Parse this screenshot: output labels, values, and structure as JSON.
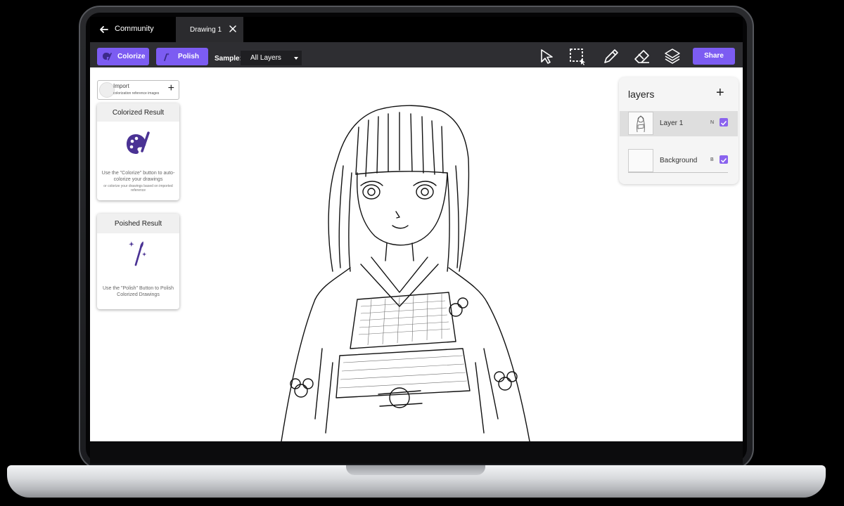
{
  "window": {
    "back_icon": "arrow-left-icon",
    "back_label": "Community",
    "tab": {
      "label": "Drawing 1",
      "close_icon": "close-icon"
    }
  },
  "toolbar": {
    "colorize_label": "Colorize",
    "colorize_icon": "palette-brush-icon",
    "polish_label": "Polish",
    "polish_icon": "magic-brush-icon",
    "sample_label": "Sample:",
    "sample_value": "All Layers",
    "tools": [
      "select-arrow-icon",
      "selection-marquee-icon",
      "pencil-icon",
      "eraser-icon",
      "layers-icon"
    ],
    "share_label": "Share",
    "accent_color": "#7c5cf2"
  },
  "left_panel": {
    "import": {
      "title": "Import",
      "subtitle": "colorization reference images",
      "plus_icon": "plus-icon"
    },
    "colorized_card": {
      "title": "Colorized Result",
      "icon": "palette-brush-icon",
      "description": "Use the \"Colorize\" button to auto-colorize your drawings",
      "small_text": "or colorize your drawings based on imported reference"
    },
    "polished_card": {
      "title": "Poished Result",
      "icon": "magic-brush-icon",
      "description": "Use the \"Polish\" Button to Polish Colorized Drawings"
    }
  },
  "layers_panel": {
    "title": "layers",
    "add_icon": "plus-icon",
    "layers": [
      {
        "name": "Layer 1",
        "mode": "N",
        "visible": true,
        "selected": true
      },
      {
        "name": "Background",
        "mode": "B",
        "visible": true,
        "selected": false
      }
    ]
  },
  "canvas": {
    "content": "line-art-drawing-girl-in-kimono"
  }
}
